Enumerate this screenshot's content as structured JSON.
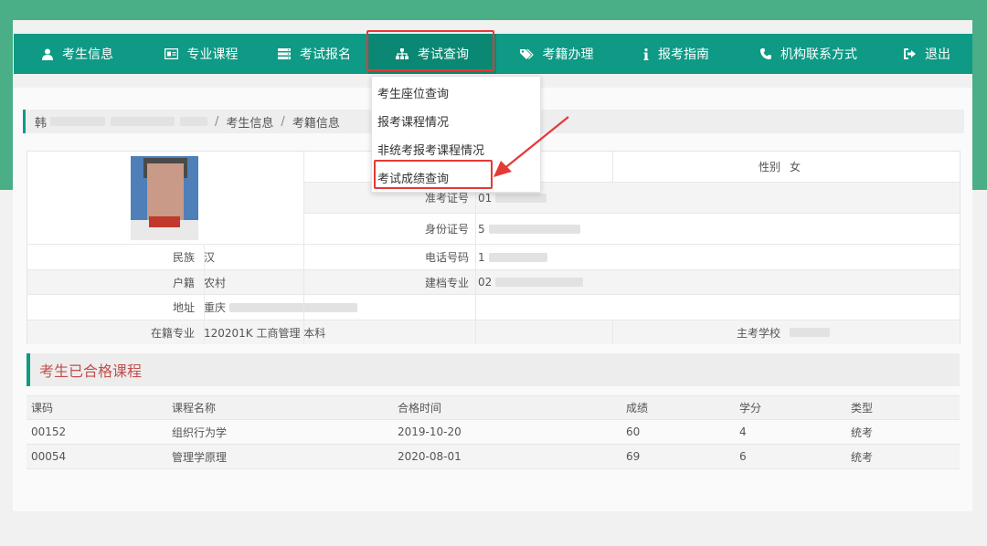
{
  "nav": {
    "items": [
      {
        "label": "考生信息",
        "icon": "user-icon"
      },
      {
        "label": "专业课程",
        "icon": "id-card-icon"
      },
      {
        "label": "考试报名",
        "icon": "server-icon"
      },
      {
        "label": "考试查询",
        "icon": "sitemap-icon"
      },
      {
        "label": "考籍办理",
        "icon": "tags-icon"
      },
      {
        "label": "报考指南",
        "icon": "info-icon"
      },
      {
        "label": "机构联系方式",
        "icon": "phone-icon"
      },
      {
        "label": "退出",
        "icon": "sign-out-icon"
      }
    ],
    "active": "考试查询"
  },
  "dropdown": {
    "items": [
      "考生座位查询",
      "报考课程情况",
      "非统考报考课程情况",
      "考试成绩查询"
    ],
    "highlighted": "考试成绩查询"
  },
  "breadcrumb": {
    "first": "韩",
    "second": "考生信息",
    "third": "考籍信息"
  },
  "profile": {
    "gender_label": "性别",
    "gender_value": "女",
    "exam_id_label": "准考证号",
    "exam_id_value": "01",
    "id_label": "身份证号",
    "id_value": "5",
    "ethnicity_label": "民族",
    "ethnicity_value": "汉",
    "phone_label": "电话号码",
    "phone_value": "1",
    "household_label": "户籍",
    "household_value": "农村",
    "record_major_label": "建档专业",
    "record_major_value": "02",
    "address_label": "地址",
    "address_value": "重庆",
    "enrolled_major_label": "在籍专业",
    "enrolled_major_value": "120201K 工商管理 本科",
    "school_label": "主考学校"
  },
  "passed": {
    "title": "考生已合格课程",
    "headers": [
      "课码",
      "课程名称",
      "合格时间",
      "成绩",
      "学分",
      "类型"
    ],
    "rows": [
      [
        "00152",
        "组织行为学",
        "2019-10-20",
        "60",
        "4",
        "统考"
      ],
      [
        "00054",
        "管理学原理",
        "2020-08-01",
        "69",
        "6",
        "统考"
      ]
    ]
  },
  "colors": {
    "nav_bg": "#0e9a85",
    "top_band": "#4aae87",
    "highlight_red": "#e53935",
    "section_title": "#c0504d"
  }
}
